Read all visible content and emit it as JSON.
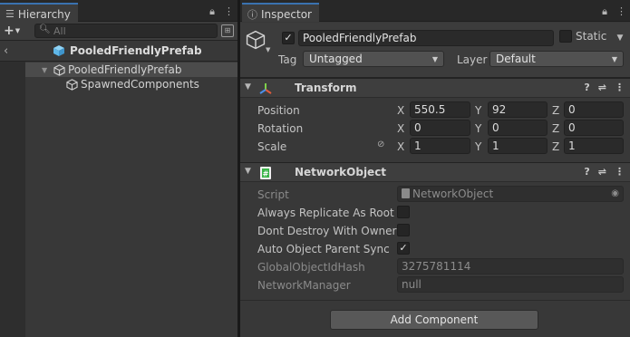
{
  "hierarchy": {
    "tab_label": "Hierarchy",
    "search_placeholder": "All",
    "prefab_title": "PooledFriendlyPrefab",
    "tree": [
      {
        "label": "PooledFriendlyPrefab",
        "selected": true,
        "expanded": true,
        "icon": "cube-outline-icon"
      },
      {
        "label": "SpawnedComponents",
        "selected": false,
        "expanded": false,
        "icon": "cube-outline-icon"
      }
    ]
  },
  "inspector": {
    "tab_label": "Inspector",
    "gameobject": {
      "active": true,
      "name": "PooledFriendlyPrefab",
      "static_label": "Static",
      "static": false,
      "tag_label": "Tag",
      "tag_value": "Untagged",
      "layer_label": "Layer",
      "layer_value": "Default"
    },
    "transform": {
      "title": "Transform",
      "position_label": "Position",
      "rotation_label": "Rotation",
      "scale_label": "Scale",
      "axis_x": "X",
      "axis_y": "Y",
      "axis_z": "Z",
      "position": {
        "x": "550.5",
        "y": "92",
        "z": "0"
      },
      "rotation": {
        "x": "0",
        "y": "0",
        "z": "0"
      },
      "scale": {
        "x": "1",
        "y": "1",
        "z": "1"
      }
    },
    "network_object": {
      "title": "NetworkObject",
      "script_label": "Script",
      "script_value": "NetworkObject",
      "always_replicate_label": "Always Replicate As Root",
      "always_replicate": false,
      "dont_destroy_label": "Dont Destroy With Owner",
      "dont_destroy": false,
      "auto_parent_label": "Auto Object Parent Sync",
      "auto_parent": true,
      "hash_label": "GlobalObjectIdHash",
      "hash_value": "3275781114",
      "manager_label": "NetworkManager",
      "manager_value": "null"
    },
    "add_component_label": "Add Component"
  },
  "colors": {
    "panel_bg": "#383838",
    "selected_row": "#4b4b4b",
    "tab_accent": "#3a72b0",
    "prefab_blue": "#5fb7e8",
    "script_green": "#3cb54a"
  }
}
